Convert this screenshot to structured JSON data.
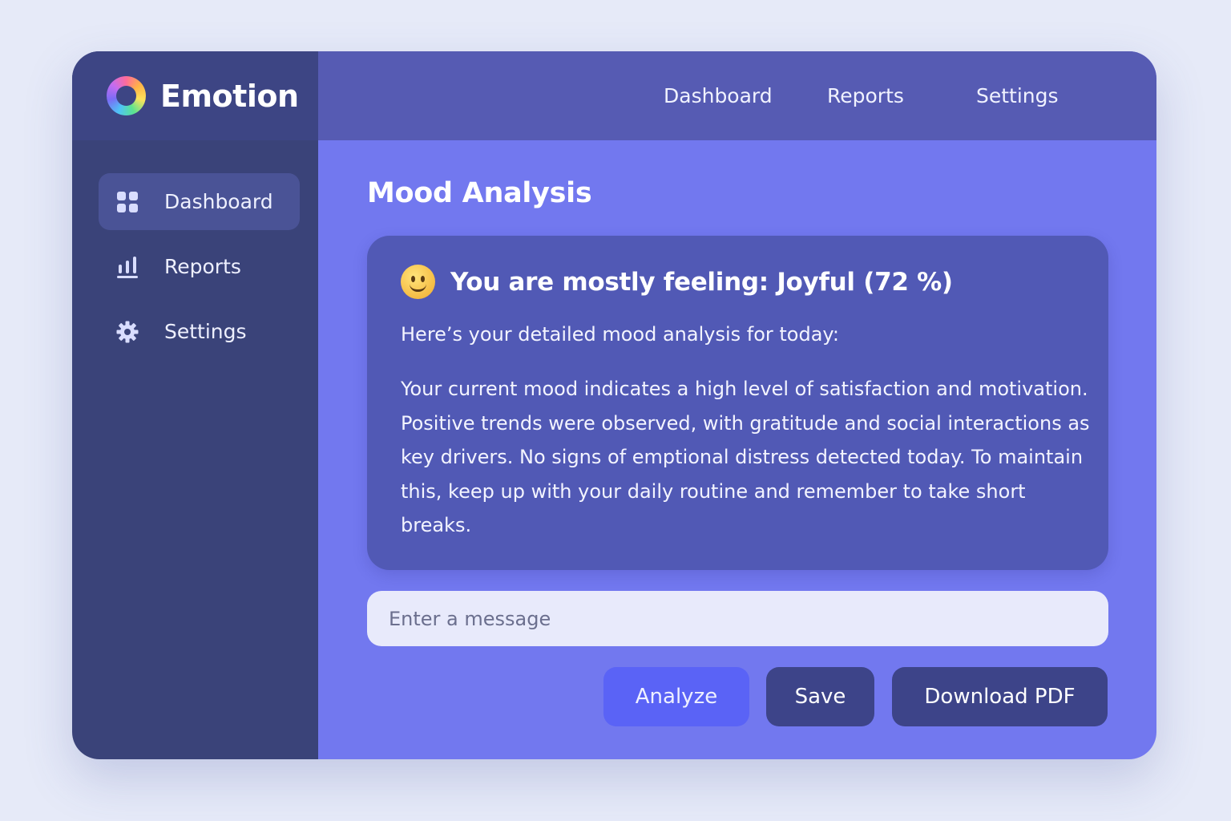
{
  "brand": {
    "title": "Emotion"
  },
  "sidebar": {
    "items": [
      {
        "label": "Dashboard",
        "icon": "grid-icon",
        "active": true
      },
      {
        "label": "Reports",
        "icon": "bar-chart-icon",
        "active": false
      },
      {
        "label": "Settings",
        "icon": "gear-icon",
        "active": false
      }
    ]
  },
  "topnav": {
    "dashboard": "Dashboard",
    "reports": "Reports",
    "settings": "Settings"
  },
  "main": {
    "title": "Mood Analysis",
    "card": {
      "emoji": "smiling-face",
      "mood_text": "You are mostly feeling: Joyful (72 %)",
      "intro": "Here’s your detailed mood analysis for today:",
      "body": "Your current mood indicates a high level of satisfaction and motivation. Positive trends were observed, with gratitude and social interactions as key drivers. No signs of emptional distress detected today. To maintain this, keep up with your daily routine and remember to take short breaks."
    },
    "input": {
      "placeholder": "Enter a message",
      "value": ""
    },
    "buttons": {
      "analyze": "Analyze",
      "save": "Save",
      "download": "Download PDF"
    }
  },
  "colors": {
    "sidebar_bg": "#3a4379",
    "main_bg": "#7278ef",
    "topbar_bg": "#565bb3",
    "card_bg": "#5159b5",
    "analyze_btn": "#5a63f6",
    "dark_btn": "#3d4489"
  }
}
